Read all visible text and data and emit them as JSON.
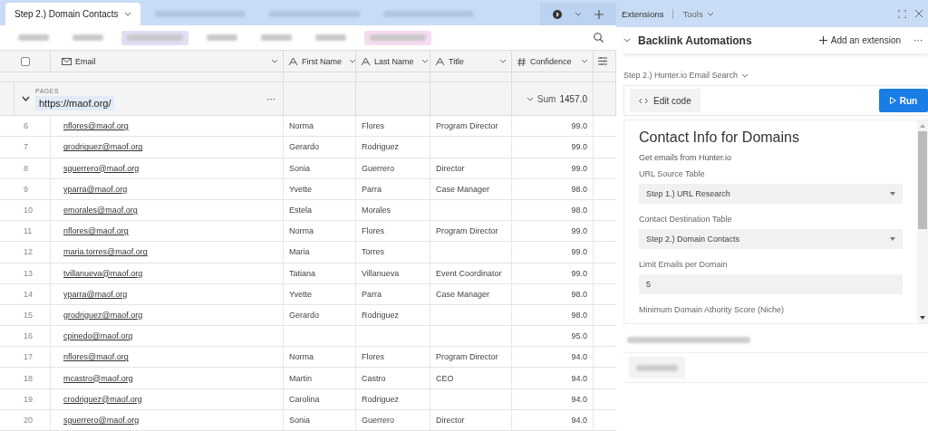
{
  "tabs": [
    {
      "kind": "text",
      "label": "Step 2.) Domain Contacts",
      "selected": true
    },
    {
      "kind": "blurred",
      "selected": false
    },
    {
      "kind": "blurred",
      "selected": false
    },
    {
      "kind": "blurred",
      "selected": false
    }
  ],
  "toolbar": [
    {
      "kind": "blurred"
    },
    {
      "kind": "blurred"
    },
    {
      "kind": "blurred",
      "color": "#e4ddf6"
    },
    {
      "kind": "blurred"
    },
    {
      "kind": "blurred"
    },
    {
      "kind": "blurred"
    },
    {
      "kind": "blurred",
      "color": "#f6dcf1"
    }
  ],
  "table": {
    "select_all_checked": false,
    "columns": [
      {
        "kind": "email",
        "label": "Email"
      },
      {
        "kind": "text",
        "label": "First Name"
      },
      {
        "kind": "text",
        "label": "Last Name"
      },
      {
        "kind": "text",
        "label": "Title"
      },
      {
        "kind": "number",
        "label": "Confidence"
      }
    ],
    "group": {
      "label": "PAGES",
      "value": "https://maof.org/",
      "more": "···",
      "sum_label": "Sum",
      "sum": "1457.0"
    },
    "rows": [
      {
        "number": "6",
        "email": "nflores@maof.org",
        "first_name": "Norma",
        "last_name": "Flores",
        "title": "Program Director",
        "confidence": "99.0"
      },
      {
        "number": "7",
        "email": "grodriguez@maof.org",
        "first_name": "Gerardo",
        "last_name": "Rodriguez",
        "confidence": "99.0"
      },
      {
        "number": "8",
        "email": "sguerrero@maof.org",
        "first_name": "Sonia",
        "last_name": "Guerrero",
        "title": "Director",
        "confidence": "99.0"
      },
      {
        "number": "9",
        "email": "yparra@maof.org",
        "first_name": "Yvette",
        "last_name": "Parra",
        "title": "Case Manager",
        "confidence": "98.0"
      },
      {
        "number": "10",
        "email": "emorales@maof.org",
        "first_name": "Estela",
        "last_name": "Morales",
        "confidence": "98.0"
      },
      {
        "number": "11",
        "email": "nflores@maof.org",
        "first_name": "Norma",
        "last_name": "Flores",
        "title": "Program Director",
        "confidence": "99.0"
      },
      {
        "number": "12",
        "email": "maria.torres@maof.org",
        "first_name": "Maria",
        "last_name": "Torres",
        "confidence": "99.0"
      },
      {
        "number": "13",
        "email": "tvillanueva@maof.org",
        "first_name": "Tatiana",
        "last_name": "Villanueva",
        "title": "Event Coordinator",
        "confidence": "99.0"
      },
      {
        "number": "14",
        "email": "yparra@maof.org",
        "first_name": "Yvette",
        "last_name": "Parra",
        "title": "Case Manager",
        "confidence": "98.0"
      },
      {
        "number": "15",
        "email": "grodriguez@maof.org",
        "first_name": "Gerardo",
        "last_name": "Rodriguez",
        "confidence": "98.0"
      },
      {
        "number": "16",
        "email": "cpinedo@maof.org",
        "confidence": "95.0"
      },
      {
        "number": "17",
        "email": "nflores@maof.org",
        "first_name": "Norma",
        "last_name": "Flores",
        "title": "Program Director",
        "confidence": "94.0"
      },
      {
        "number": "18",
        "email": "mcastro@maof.org",
        "first_name": "Martin",
        "last_name": "Castro",
        "title": "CEO",
        "confidence": "94.0"
      },
      {
        "number": "19",
        "email": "crodriguez@maof.org",
        "first_name": "Carolina",
        "last_name": "Rodriguez",
        "confidence": "94.0"
      },
      {
        "number": "20",
        "email": "sguerrero@maof.org",
        "first_name": "Sonia",
        "last_name": "Guerrero",
        "title": "Director",
        "confidence": "94.0"
      }
    ]
  },
  "extensions": {
    "tabs": [
      {
        "label": "Extensions",
        "selected": true
      },
      {
        "label": "Tools",
        "selected": false
      }
    ],
    "title": "Backlink Automations",
    "add_label": "Add an extension",
    "more": "···",
    "script_name": "Step 2.) Hunter.io Email Search",
    "edit_label": "Edit code",
    "run_label": "Run",
    "form": {
      "heading": "Contact Info for Domains",
      "subtitle": "Get emails from Hunter.io",
      "fields": [
        {
          "kind": "select",
          "label": "URL Source Table",
          "value": "Step 1.) URL Research"
        },
        {
          "kind": "select",
          "label": "Contact Destination Table",
          "value": "Step 2.) Domain Contacts"
        },
        {
          "kind": "input",
          "label": "Limit Emails per Domain",
          "value": "5"
        },
        {
          "kind": "label",
          "label": "Minimum Domain Athority Score (Niche)"
        }
      ]
    }
  }
}
